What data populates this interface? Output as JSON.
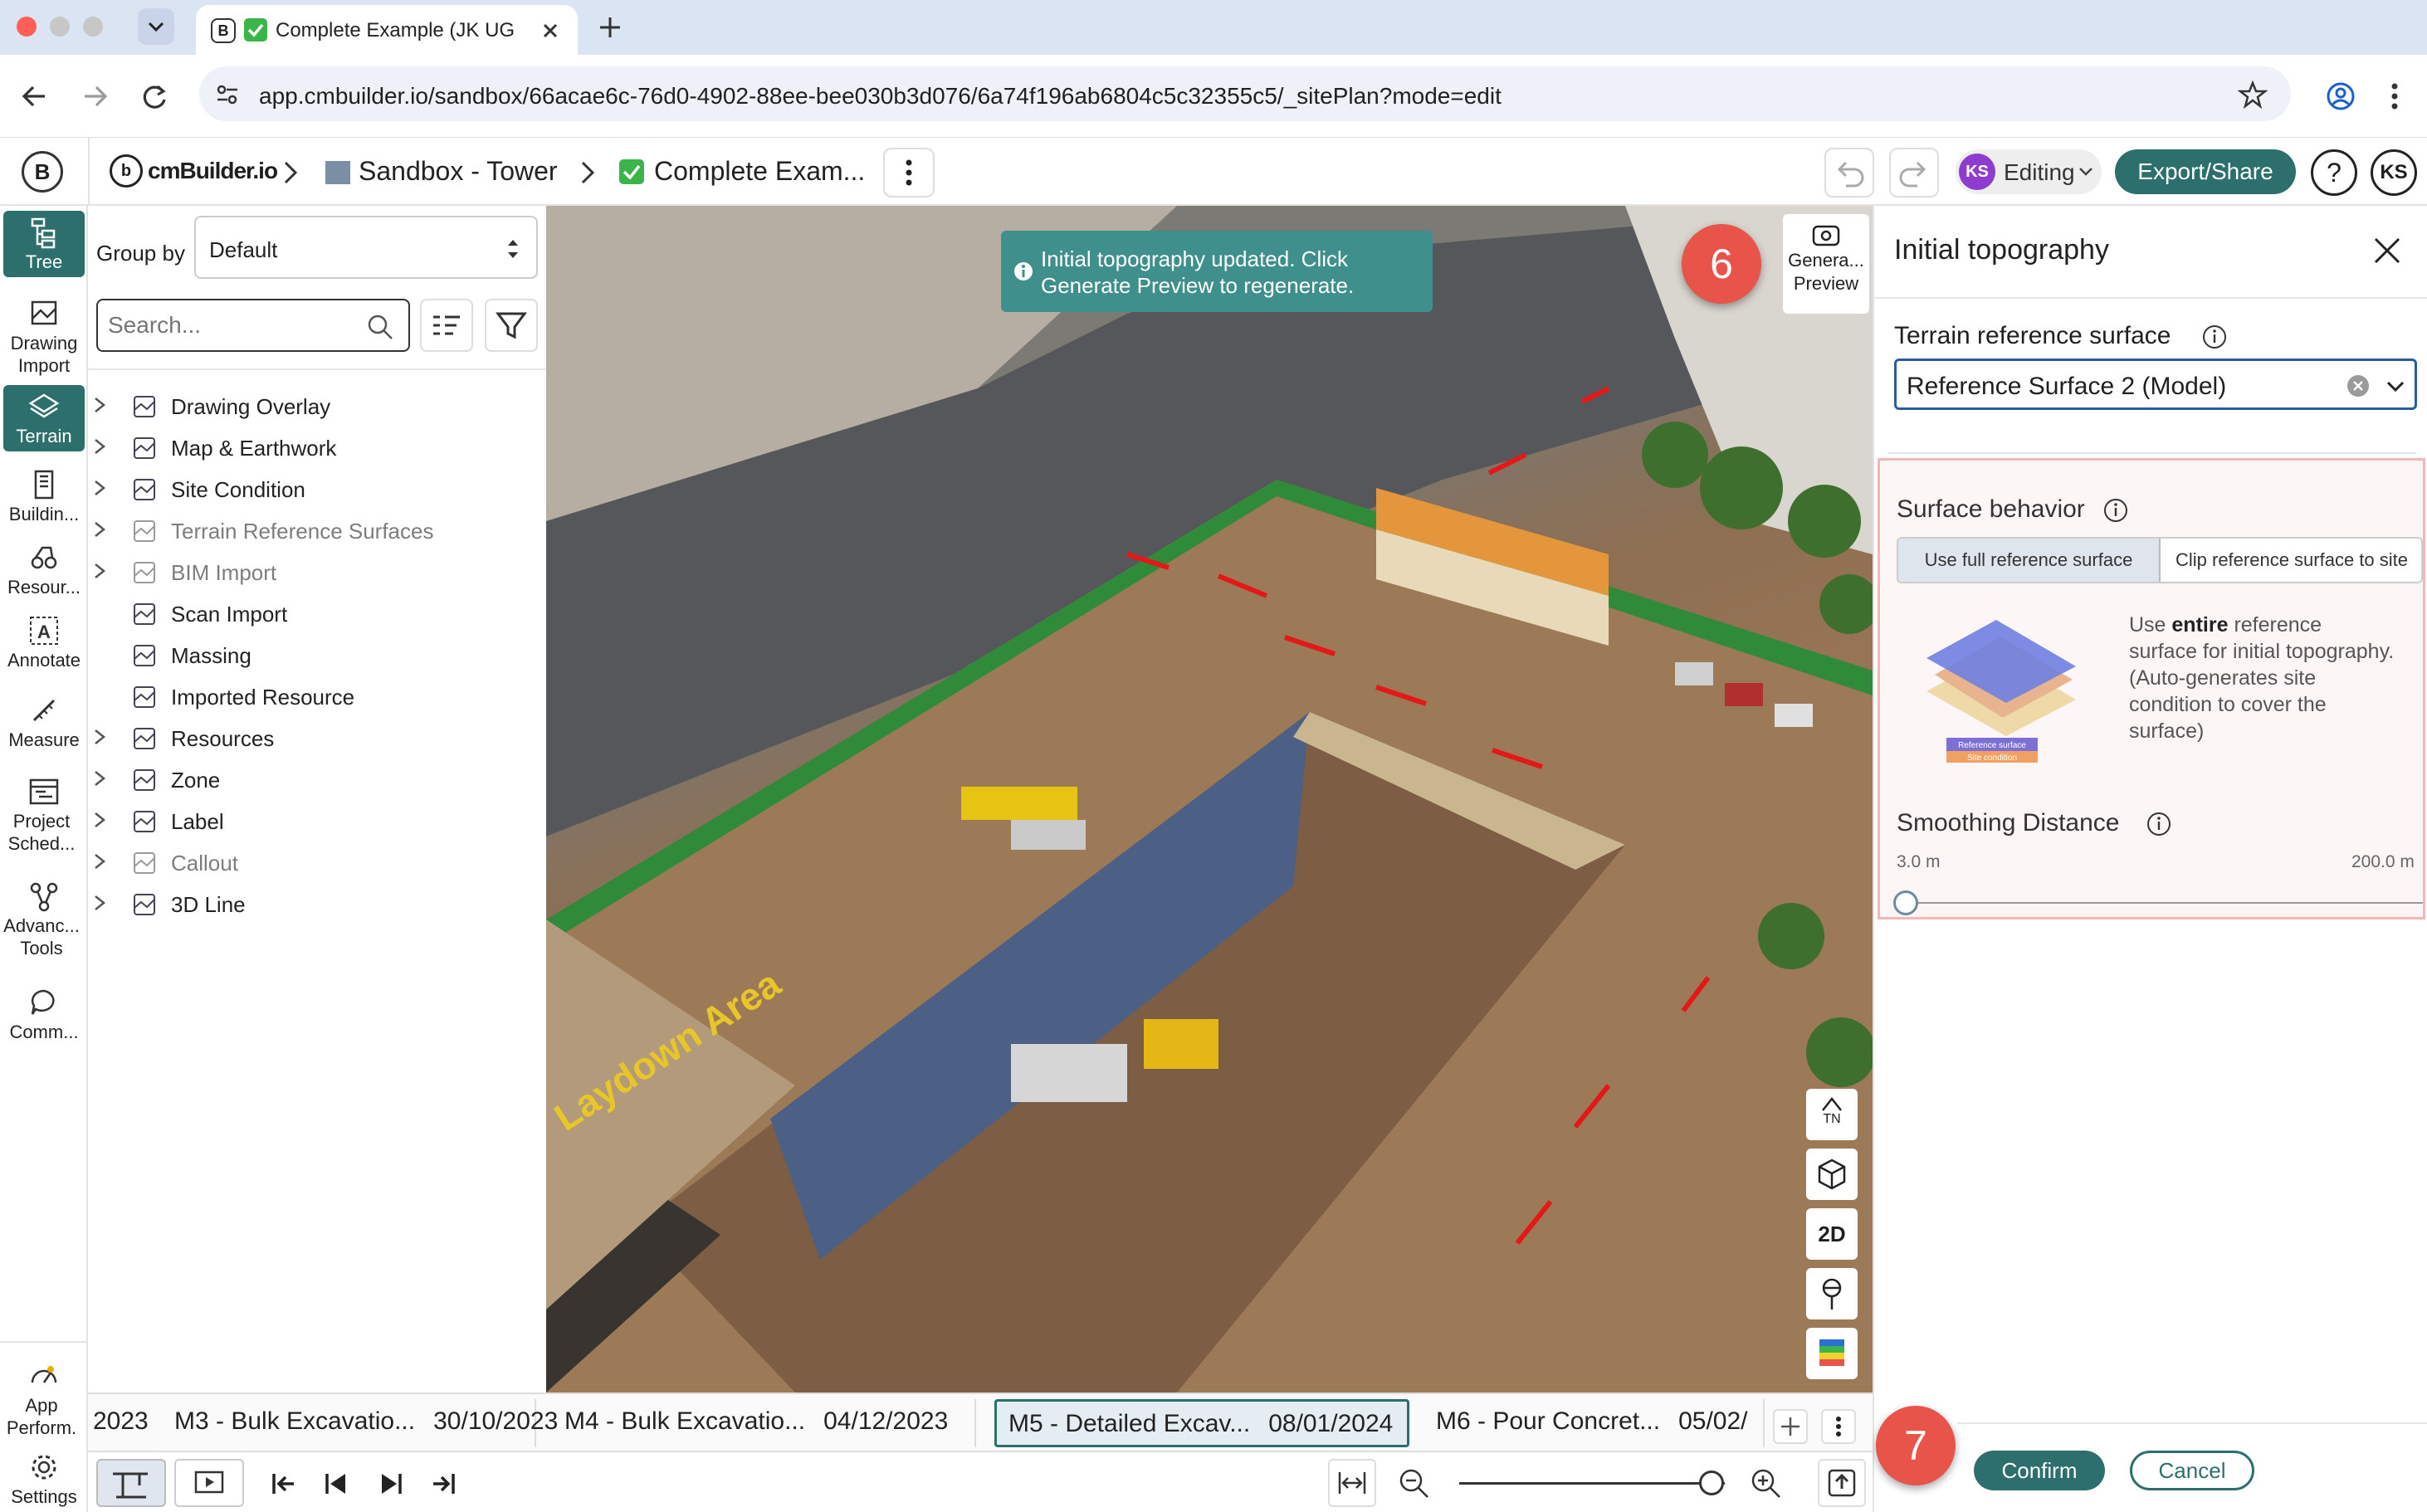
{
  "browser": {
    "tab_title": "Complete Example (JK UG",
    "url": "app.cmbuilder.io/sandbox/66acae6c-76d0-4902-88ee-bee030b3d076/6a74f196ab6804c5c32355c5/_sitePlan?mode=edit"
  },
  "app": {
    "logo_text": "cmBuilder.io",
    "breadcrumbs": [
      "Sandbox - Tower",
      "Complete Exam..."
    ],
    "user_initials": "KS",
    "mode": "Editing",
    "export_label": "Export/Share",
    "help_label": "?"
  },
  "rail": {
    "items": [
      {
        "label": "Tree",
        "icon": "tree-icon"
      },
      {
        "label": "Drawing Import",
        "icon": "drawing-import-icon"
      },
      {
        "label": "Terrain",
        "icon": "terrain-icon"
      },
      {
        "label": "Buildin...",
        "icon": "building-icon"
      },
      {
        "label": "Resour...",
        "icon": "resource-icon"
      },
      {
        "label": "Annotate",
        "icon": "annotate-icon"
      },
      {
        "label": "Measure",
        "icon": "measure-icon"
      },
      {
        "label": "Project Sched...",
        "icon": "schedule-icon"
      },
      {
        "label": "Advanc... Tools",
        "icon": "advanced-tools-icon"
      },
      {
        "label": "Comm...",
        "icon": "comment-icon"
      },
      {
        "label": "App Perform.",
        "icon": "app-performance-icon"
      },
      {
        "label": "Settings",
        "icon": "gear-icon"
      }
    ]
  },
  "tree": {
    "group_by_label": "Group by",
    "group_by_value": "Default",
    "search_placeholder": "Search...",
    "items": [
      {
        "label": "Drawing Overlay",
        "expandable": true,
        "dim": false
      },
      {
        "label": "Map & Earthwork",
        "expandable": true,
        "dim": false
      },
      {
        "label": "Site Condition",
        "expandable": true,
        "dim": false
      },
      {
        "label": "Terrain Reference Surfaces",
        "expandable": true,
        "dim": true
      },
      {
        "label": "BIM Import",
        "expandable": true,
        "dim": true
      },
      {
        "label": "Scan Import",
        "expandable": false,
        "dim": false
      },
      {
        "label": "Massing",
        "expandable": false,
        "dim": false
      },
      {
        "label": "Imported Resource",
        "expandable": false,
        "dim": false
      },
      {
        "label": "Resources",
        "expandable": true,
        "dim": false
      },
      {
        "label": "Zone",
        "expandable": true,
        "dim": false
      },
      {
        "label": "Label",
        "expandable": true,
        "dim": false
      },
      {
        "label": "Callout",
        "expandable": true,
        "dim": true
      },
      {
        "label": "3D Line",
        "expandable": true,
        "dim": false
      }
    ]
  },
  "viewport": {
    "toast": "Initial topography updated. Click Generate Preview to regenerate.",
    "generate_preview_label_1": "Genera...",
    "generate_preview_label_2": "Preview",
    "laydown_text": "Laydown Area",
    "nav_buttons": {
      "north": "TN",
      "view2d": "2D"
    }
  },
  "annotations": {
    "step6": "6",
    "step7": "7"
  },
  "panel": {
    "title": "Initial topography",
    "terrain_ref_label": "Terrain reference surface",
    "terrain_ref_value": "Reference Surface 2 (Model)",
    "surface_behavior_label": "Surface behavior",
    "option_full": "Use full reference surface",
    "option_clip": "Clip reference surface to site",
    "desc_prefix": "Use ",
    "desc_bold": "entire",
    "desc_suffix": " reference surface for initial topography. (Auto-generates site condition to cover the surface)",
    "illus_label_1": "Reference surface",
    "illus_label_2": "Site condition",
    "smoothing_label": "Smoothing Distance",
    "smoothing_min": "3.0 m",
    "smoothing_max": "200.0 m",
    "smoothing_value": 0,
    "confirm_label": "Confirm",
    "cancel_label": "Cancel"
  },
  "timeline": {
    "partial_date": "2023",
    "milestones": [
      {
        "name": "M3 - Bulk Excavatio...",
        "date": "30/10/2023",
        "selected": false
      },
      {
        "name": "M4 - Bulk Excavatio...",
        "date": "04/12/2023",
        "selected": false
      },
      {
        "name": "M5 - Detailed Excav...",
        "date": "08/01/2024",
        "selected": true
      },
      {
        "name": "M6 - Pour Concret...",
        "date": "05/02/",
        "selected": false
      }
    ],
    "zoom_level": 0.95
  },
  "colors": {
    "accent": "#2d6f6d",
    "annotation": "#e8534a",
    "toast": "#3f8f8c",
    "highlight_border": "#f2b8b8"
  }
}
